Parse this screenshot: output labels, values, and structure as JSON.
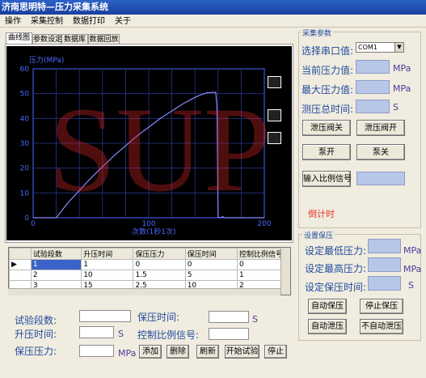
{
  "window": {
    "title": "济南思明特—压力采集系统"
  },
  "menu": [
    "操作",
    "采集控制",
    "数据打印",
    "关于"
  ],
  "tabs": [
    "曲线图",
    "参数设定",
    "数据库",
    "数据回放"
  ],
  "chart": {
    "ylabel": "压力(MPa)",
    "xlabel": "次数(1秒1次)",
    "yticks": [
      "60",
      "50",
      "40",
      "30",
      "20",
      "10",
      "0"
    ],
    "xticks": [
      "0",
      "100",
      "200"
    ]
  },
  "chart_data": {
    "type": "line",
    "xlabel": "次数(1秒1次)",
    "ylabel": "压力(MPa)",
    "xlim": [
      0,
      200
    ],
    "ylim": [
      0,
      60
    ],
    "series": [
      {
        "x": [
          0,
          20,
          25,
          30,
          40,
          50,
          60,
          70,
          80,
          90,
          100,
          110,
          120,
          130,
          140,
          145,
          150,
          155,
          158,
          159,
          160,
          161,
          162,
          163,
          164,
          165,
          168,
          200
        ],
        "y": [
          0,
          0,
          3,
          6,
          11,
          16,
          20.5,
          25,
          29,
          33,
          36.5,
          40,
          43,
          46,
          48.5,
          49.5,
          50.3,
          50.5,
          50.5,
          45,
          0.3,
          0.1,
          0.1,
          0.1,
          0.5,
          0.1,
          0,
          0
        ]
      }
    ]
  },
  "table": {
    "headers": [
      "试验段数",
      "升压时间",
      "保压压力",
      "保压时间",
      "控制比例信号"
    ],
    "rows": [
      [
        "1",
        "1",
        "0",
        "0",
        "0"
      ],
      [
        "2",
        "10",
        "1.5",
        "5",
        "1"
      ],
      [
        "3",
        "15",
        "2.5",
        "10",
        "2"
      ]
    ]
  },
  "form": {
    "seg_label": "试验段数:",
    "rise_label": "升压时间:",
    "rise_unit": "S",
    "press_label": "保压压力:",
    "press_unit": "MPa",
    "hold_label": "保压时间:",
    "hold_unit": "S",
    "ratio_label": "控制比例信号:"
  },
  "buttons": {
    "add": "添加",
    "delete": "删除",
    "refresh": "刷新",
    "start": "开始试验",
    "stop": "停止"
  },
  "acq": {
    "group": "采集参数",
    "port_label": "选择串口值:",
    "port_value": "COM1",
    "cur_label": "当前压力值:",
    "max_label": "最大压力值:",
    "total_label": "测压总时间:",
    "unit_mpa": "MPa",
    "unit_s": "S",
    "btn_valve_close": "泄压阀关",
    "btn_valve_open": "泄压阀开",
    "btn_pump_on": "泵开",
    "btn_pump_off": "泵关",
    "btn_ratio": "输入比例信号",
    "countdown": "倒计时"
  },
  "hold": {
    "group": "设置保压",
    "min_label": "设定最低压力:",
    "max_label": "设定最高压力:",
    "time_label": "设定保压时间:",
    "unit_mpa": "MPa",
    "unit_s": "S",
    "btn_auto": "自动保压",
    "btn_stop": "停止保压",
    "btn_auto_release": "自动泄压",
    "btn_no_release": "不自动泄压"
  },
  "watermark": "SUP"
}
